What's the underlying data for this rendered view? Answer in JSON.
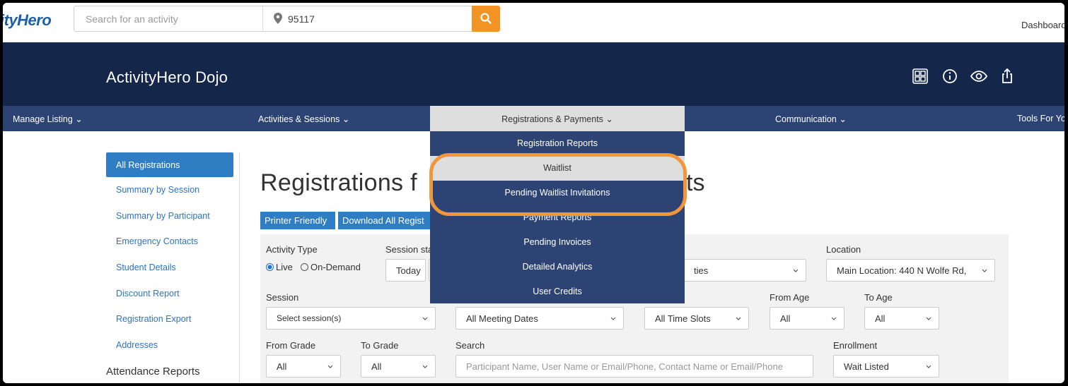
{
  "topbar": {
    "logo": "ityHero",
    "search_placeholder": "Search for an activity",
    "zip": "95117",
    "dashboard": "Dashboard"
  },
  "header": {
    "business_name": "ActivityHero Dojo",
    "icons": [
      "qr-code-icon",
      "info-icon",
      "eye-icon",
      "share-icon"
    ]
  },
  "nav": {
    "manage_listing": "Manage Listing",
    "activities_sessions": "Activities & Sessions",
    "registrations_payments": "Registrations & Payments",
    "communication": "Communication",
    "tools": "Tools For Yo"
  },
  "dropdown": {
    "items": [
      "Registration Reports",
      "Waitlist",
      "Pending Waitlist Invitations",
      "Payment Reports",
      "Pending Invoices",
      "Detailed Analytics",
      "User Credits"
    ]
  },
  "sidebar": {
    "items": [
      "All Registrations",
      "Summary by Session",
      "Summary by Participant",
      "Emergency Contacts",
      "Student Details",
      "Discount Report",
      "Registration Export",
      "Addresses"
    ],
    "heading": "Attendance Reports"
  },
  "main": {
    "title_start": "Registrations f",
    "title_end": "ts",
    "printer_friendly": "Printer Friendly",
    "download_all": "Download All Regist"
  },
  "filters": {
    "activity_type_label": "Activity Type",
    "live": "Live",
    "on_demand": "On-Demand",
    "session_start_label": "Session sta",
    "today": "Today",
    "activities_value": "ties",
    "location_label": "Location",
    "location_value": "Main Location: 440 N Wolfe Rd,",
    "session_label": "Session",
    "session_value": "Select session(s)",
    "meeting_dates_value": "All Meeting Dates",
    "time_slots_value": "All Time Slots",
    "from_age_label": "From Age",
    "from_age_value": "All",
    "to_age_label": "To Age",
    "to_age_value": "All",
    "from_grade_label": "From Grade",
    "from_grade_value": "All",
    "to_grade_label": "To Grade",
    "to_grade_value": "All",
    "search_label": "Search",
    "search_placeholder": "Participant Name, User Name or Email/Phone, Contact Name or Email/Phone",
    "enrollment_label": "Enrollment",
    "enrollment_value": "Wait Listed"
  },
  "colors": {
    "header_bg": "#14264a",
    "nav_bg": "#2c4373",
    "accent_orange": "#f39323",
    "link_blue": "#2d74c4"
  }
}
